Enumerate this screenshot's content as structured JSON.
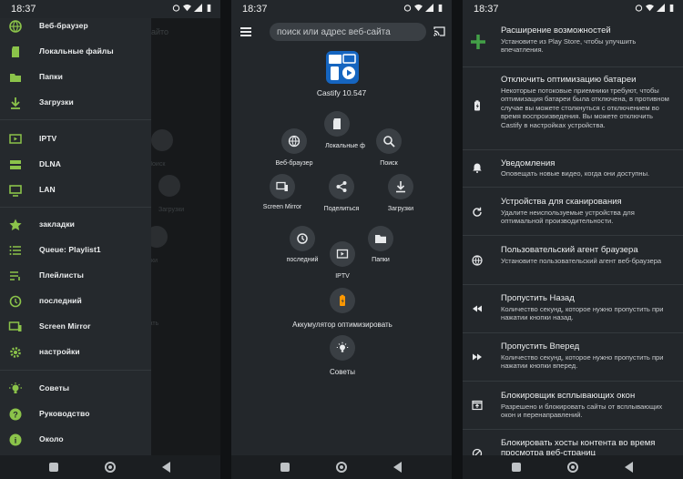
{
  "status": {
    "time": "18:37"
  },
  "drawer": {
    "items": [
      {
        "label": "Веб-браузер",
        "icon": "globe-icon"
      },
      {
        "label": "Локальные файлы",
        "icon": "sd-card-icon"
      },
      {
        "label": "Папки",
        "icon": "folder-icon"
      },
      {
        "label": "Загрузки",
        "icon": "download-icon"
      },
      {
        "label": "IPTV",
        "icon": "tv-play-icon"
      },
      {
        "label": "DLNA",
        "icon": "server-icon"
      },
      {
        "label": "LAN",
        "icon": "monitor-icon"
      },
      {
        "label": "закладки",
        "icon": "star-icon"
      },
      {
        "label": "Queue: Playlist1",
        "icon": "queue-icon"
      },
      {
        "label": "Плейлисты",
        "icon": "playlist-icon"
      },
      {
        "label": "последний",
        "icon": "history-icon"
      },
      {
        "label": "Screen Mirror",
        "icon": "screen-mirror-icon"
      },
      {
        "label": "настройки",
        "icon": "gear-icon"
      },
      {
        "label": "Советы",
        "icon": "lightbulb-icon"
      },
      {
        "label": "Руководство",
        "icon": "help-icon"
      },
      {
        "label": "Около",
        "icon": "info-icon"
      }
    ],
    "background_ghosts": [
      "айто",
      "Поиск",
      "Загрузки",
      "ки",
      "вать"
    ]
  },
  "home": {
    "search_placeholder": "поиск или адрес веб-сайта",
    "app_version": "Castify 10.547",
    "buttons": {
      "local": "Локальные ф",
      "web": "Веб-браузер",
      "search": "Поиск",
      "mirror": "Screen Mirror",
      "share": "Поделиться",
      "downloads": "Загрузки",
      "recent": "последний",
      "folders": "Папки",
      "iptv": "IPTV",
      "battery": "Аккумулятор оптимизировать",
      "tips": "Советы"
    }
  },
  "settings": {
    "items": [
      {
        "title": "Расширение возможностей",
        "desc": "Установите из Play Store, чтобы улучшить впечатления.",
        "icon": "plus-icon"
      },
      {
        "title": "Отключить оптимизацию батареи",
        "desc": "Некоторые потоковые приемники требуют, чтобы оптимизация батареи была отключена, в противном случае вы можете столкнуться с отключением во время воспроизведения. Вы можете отключить Castify в настройках устройства.",
        "icon": "battery-icon"
      },
      {
        "title": "Уведомления",
        "desc": "Оповещать новые видео, когда они доступны.",
        "icon": "bell-icon"
      },
      {
        "title": "Устройства для сканирования",
        "desc": "Удалите неиспользуемые устройства для оптимальной производительности.",
        "icon": "refresh-icon"
      },
      {
        "title": "Пользовательский агент браузера",
        "desc": "Установите пользовательский агент веб-браузера",
        "icon": "globe-icon"
      },
      {
        "title": "Пропустить Назад",
        "desc": "Количество секунд, которое нужно пропустить при нажатии кнопки назад.",
        "icon": "rewind-icon"
      },
      {
        "title": "Пропустить Вперед",
        "desc": "Количество секунд, которое нужно пропустить при нажатии кнопки вперед.",
        "icon": "fast-forward-icon"
      },
      {
        "title": "Блокировщик всплывающих окон",
        "desc": "Разрешено и блокировать сайты от всплывающих окон и перенаправлений.",
        "icon": "popup-icon"
      },
      {
        "title": "Блокировать хосты контента во время",
        "desc": "просмотра веб-страниц",
        "icon": "block-icon"
      }
    ]
  },
  "colors": {
    "accent_green": "#8bc34a",
    "plus_green": "#43a047",
    "battery_orange": "#ff9800",
    "bg": "#23272b"
  }
}
